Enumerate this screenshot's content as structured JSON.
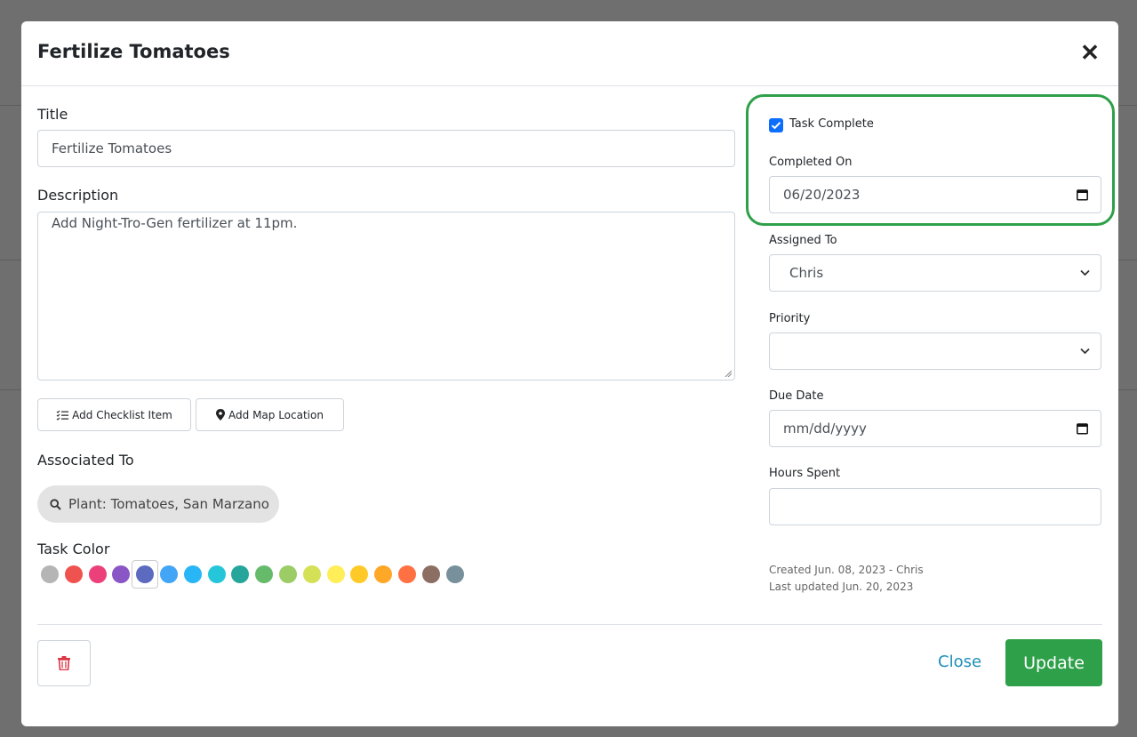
{
  "modal": {
    "title": "Fertilize Tomatoes",
    "close_symbol": "✕"
  },
  "form": {
    "title_label": "Title",
    "title_value": "Fertilize Tomatoes",
    "description_label": "Description",
    "description_value": "Add Night-Tro-Gen fertilizer at 11pm.",
    "add_checklist_label": "Add Checklist Item",
    "add_map_label": "Add Map Location",
    "associated_label": "Associated To",
    "associated_value": "Plant: Tomatoes, San Marzano",
    "task_color_label": "Task Color",
    "task_colors": [
      "#b5b5b5",
      "#ef5350",
      "#ec407a",
      "#8a56c6",
      "#5c6bc0",
      "#42a5f5",
      "#29b6f6",
      "#26c6da",
      "#26a69a",
      "#66bb6a",
      "#9ccc65",
      "#d4e157",
      "#ffee58",
      "#ffca28",
      "#ffa726",
      "#ff7043",
      "#8d6e63",
      "#78909c"
    ],
    "selected_color_index": 4
  },
  "side": {
    "task_complete_label": "Task Complete",
    "task_complete_checked": true,
    "completed_on_label": "Completed On",
    "completed_on_value": "06/20/2023",
    "assigned_label": "Assigned To",
    "assigned_value": "Chris",
    "priority_label": "Priority",
    "priority_value": "",
    "due_label": "Due Date",
    "due_placeholder": "mm/dd/yyyy",
    "hours_label": "Hours Spent",
    "hours_value": "",
    "created_text": "Created Jun. 08, 2023 - Chris",
    "updated_text": "Last updated Jun. 20, 2023"
  },
  "footer": {
    "close_label": "Close",
    "update_label": "Update"
  },
  "colors": {
    "highlight": "#2fa04a",
    "primary_action": "#2fa04a",
    "link": "#1d8fb8",
    "delete": "#dc3545",
    "checkbox": "#0d6efd"
  },
  "icons": [
    "close-icon",
    "checklist-icon",
    "map-marker-icon",
    "search-icon",
    "calendar-icon",
    "chevron-down-icon",
    "trash-icon"
  ]
}
